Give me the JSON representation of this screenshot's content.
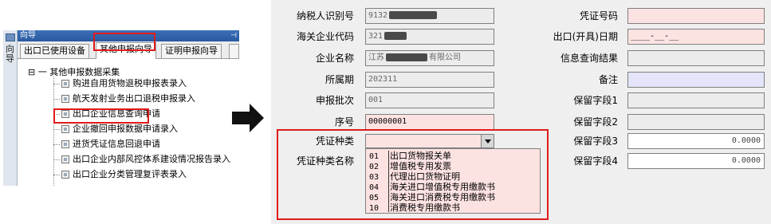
{
  "left_panel": {
    "side_tab_text": "向导",
    "window_title": "向导",
    "tabs": [
      {
        "label": "出口已使用设备"
      },
      {
        "label": "其他申报向导"
      },
      {
        "label": "证明申报向导"
      }
    ],
    "tree_root": "⊟ 一 其他申报数据采集",
    "tree_items": [
      "购进自用货物退税申报表录入",
      "航天发射业务出口退税申报录入",
      "出口企业信息查询申请",
      "企业撤回申报数据申请录入",
      "进货凭证信息回退申请",
      "出口企业内部风控体系建设情况报告录入",
      "出口企业分类管理复评表录入"
    ]
  },
  "form": {
    "left_labels": [
      "纳税人识别号",
      "海关企业代码",
      "企业名称",
      "所属期",
      "申报批次",
      "序号",
      "凭证种类",
      "凭证种类名称"
    ],
    "left_values": {
      "taxpayer_id_prefix": "9132",
      "customs_code_prefix": "321",
      "company_name_prefix": "江苏",
      "company_name_suffix": "有限公司",
      "period": "202311",
      "batch": "001",
      "serial": "00000001"
    },
    "right_labels": [
      "凭证号码",
      "出口(开具)日期",
      "信息查询结果",
      "备注",
      "保留字段1",
      "保留字段2",
      "保留字段3",
      "保留字段4"
    ],
    "right_values": {
      "export_date": "____-__-__",
      "reserved3": "0.0000",
      "reserved4": "0.0000"
    },
    "dropdown_options": [
      {
        "code": "01",
        "name": "出口货物报关单"
      },
      {
        "code": "02",
        "name": "增值税专用发票"
      },
      {
        "code": "03",
        "name": "代理出口货物证明"
      },
      {
        "code": "04",
        "name": "海关进口增值税专用缴款书"
      },
      {
        "code": "05",
        "name": "海关进口消费税专用缴款书"
      },
      {
        "code": "10",
        "name": "消费税专用缴款书"
      }
    ]
  },
  "colors": {
    "highlight": "#e01b1b",
    "required_field": "#fde2e2",
    "note_field": "#e4e4fb",
    "title_bar": "#2a5aa0"
  }
}
